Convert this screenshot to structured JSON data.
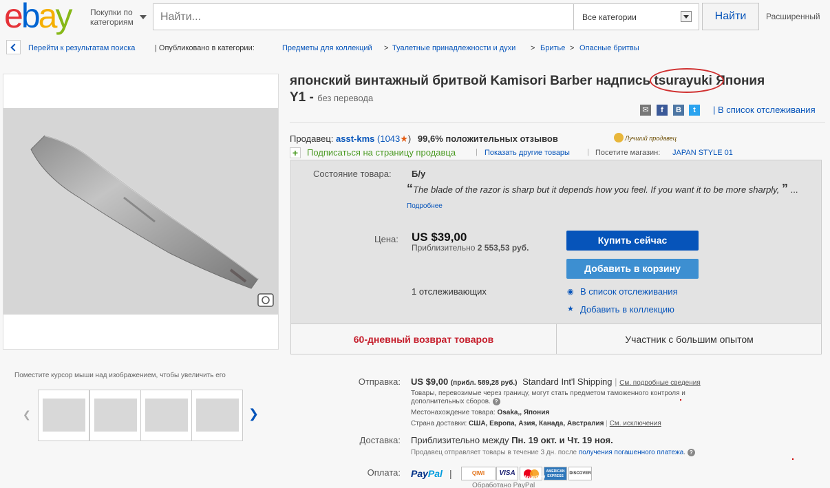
{
  "header": {
    "logo": [
      "e",
      "b",
      "a",
      "y"
    ],
    "logo_colors": [
      "#e53238",
      "#0064d2",
      "#f5af02",
      "#86b817"
    ],
    "shop_by_category": [
      "Покупки по",
      "категориям"
    ],
    "search_placeholder": "Найти...",
    "category_select": "Все категории",
    "search_button": "Найти",
    "advanced": "Расширенный"
  },
  "breadcrumb": {
    "back_to_results": "Перейти к результатам поиска",
    "listed_in": "| Опубликовано в категории:",
    "categories": [
      "Предметы для коллекций",
      "Туалетные принадлежности и духи",
      "Бритье",
      "Опасные бритвы"
    ],
    "separator": ">"
  },
  "gallery": {
    "caption": "Поместите курсор мыши над изображением, чтобы увеличить его",
    "thumb_count": 4
  },
  "item": {
    "title_part1": "японский винтажный бритвой Kamisori Barber надпись",
    "title_highlight": "tsurayuki",
    "title_part2": "Япония",
    "title_line2": "Y1 -",
    "no_translation": "без перевода",
    "add_to_watchlist": "В список отслеживания"
  },
  "seller": {
    "label": "Продавец:",
    "name": "asst-kms",
    "feedback_open": "(1043",
    "feedback_close": ")",
    "positive": "99,6% положительных отзывов",
    "top_rated": "Лучший продавец",
    "subscribe": "Подписаться на страницу продавца",
    "other_items": "Показать другие товары",
    "visit_store_label": "Посетите магазин:",
    "store_name": "JAPAN STYLE 01"
  },
  "condition": {
    "label": "Состояние товара:",
    "value": "Б/у",
    "description": "The blade of the razor is sharp but it depends how you feel. If you want it to be more sharply,",
    "ellipsis": "...",
    "more": "Подробнее"
  },
  "price": {
    "label": "Цена:",
    "value": "US $39,00",
    "approx_label": "Приблизительно",
    "approx_value": "2 553,53 руб.",
    "buy_now": "Купить сейчас",
    "add_to_cart": "Добавить в корзину",
    "watchers": "1 отслеживающих",
    "add_watch": "В список отслеживания",
    "add_collection": "Добавить в коллекцию"
  },
  "badges": {
    "returns": "60-дневный возврат товаров",
    "experienced": "Участник с большим опытом"
  },
  "shipping": {
    "label": "Отправка:",
    "cost": "US $9,00",
    "approx": "(прибл. 589,28 руб.)",
    "service": "Standard Int'l Shipping",
    "details_link": "См. подробные сведения",
    "customs_line1": "Товары, перевозимые через границу, могут стать предметом таможенного контроля и",
    "customs_line2": "дополнительных сборов.",
    "location_label": "Местонахождение товара:",
    "location": "Osaka,, Япония",
    "ships_to_label": "Страна доставки:",
    "ships_to": "США, Европа, Азия, Канада, Австралия",
    "exclusions": "См. исключения"
  },
  "delivery": {
    "label": "Доставка:",
    "text_pre": "Приблизительно между",
    "date1": "Пн. 19 окт.",
    "and": "и",
    "date2": "Чт. 19 ноя.",
    "handling_pre": "Продавец отправляет товары в течение 3 дн. после",
    "handling_link": "получения погашенного платежа",
    "handling_dot": "."
  },
  "payment": {
    "label": "Оплата:",
    "paypal_1": "Pay",
    "paypal_2": "Pal",
    "paypal_colors": [
      "#003087",
      "#009cde"
    ],
    "bar": "|",
    "cards": [
      "QIWI",
      "VISA",
      "MasterCard",
      "AMERICAN EXPRESS",
      "DISCOVER"
    ],
    "note": "Обработано PayPal"
  }
}
